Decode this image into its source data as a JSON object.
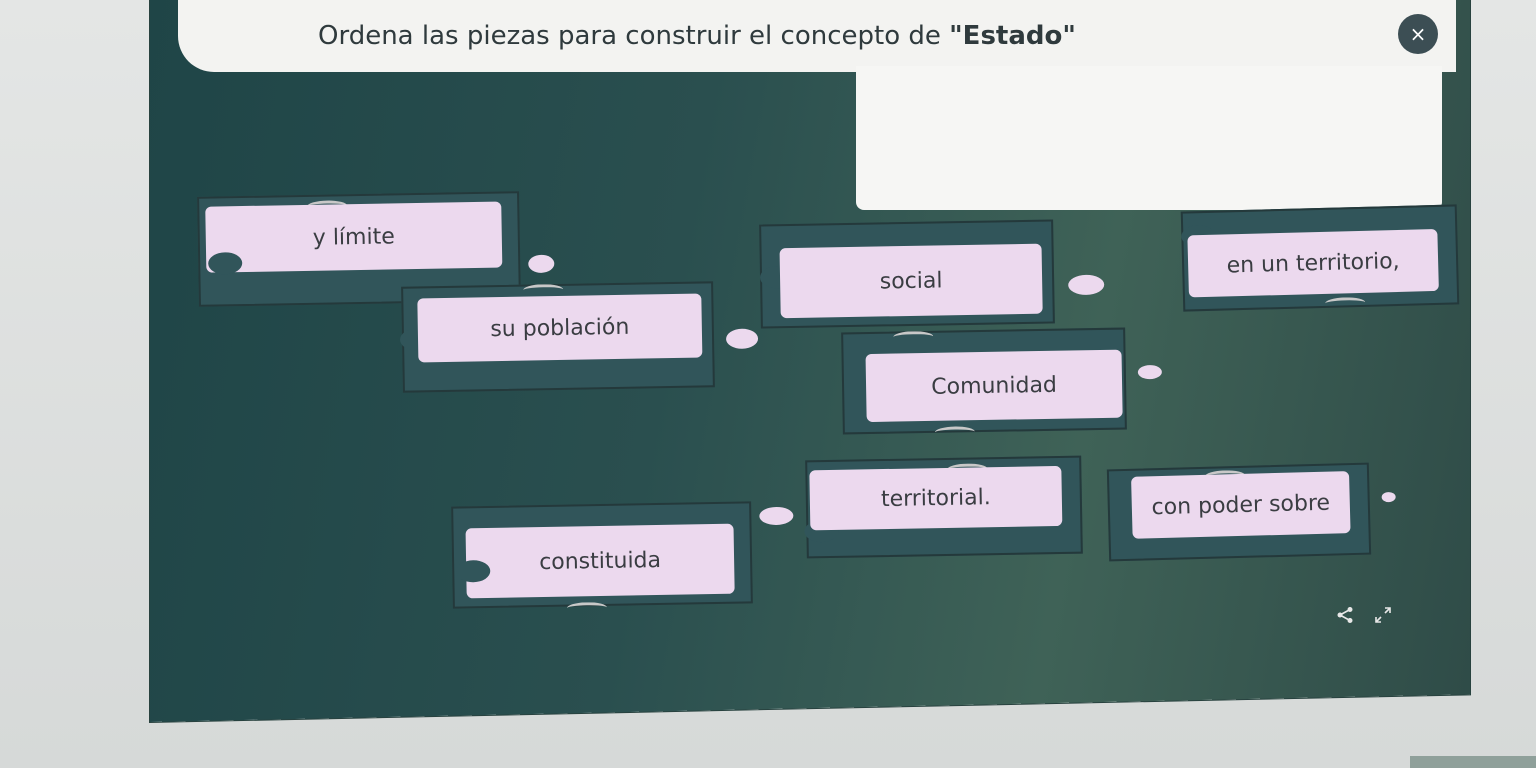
{
  "header": {
    "title_prefix": "Ordena las piezas para construir el concepto de ",
    "title_keyword": "\"Estado\"",
    "close_symbol": "×"
  },
  "pieces": [
    {
      "id": "y-limite",
      "label": "y límite"
    },
    {
      "id": "social",
      "label": "social"
    },
    {
      "id": "en-un-territorio",
      "label": "en un territorio,"
    },
    {
      "id": "su-poblacion",
      "label": "su población"
    },
    {
      "id": "comunidad",
      "label": "Comunidad"
    },
    {
      "id": "territorial",
      "label": "territorial."
    },
    {
      "id": "con-poder-sobre",
      "label": "con poder sobre"
    },
    {
      "id": "constituida",
      "label": "constituida"
    }
  ],
  "footer": {
    "share_icon": "share-icon",
    "fullscreen_icon": "fullscreen-icon"
  },
  "colors": {
    "board": "#2a4f4f",
    "piece_frame": "#31555a",
    "piece_label": "#ecd9ee",
    "title_bar": "#f3f3f1"
  }
}
